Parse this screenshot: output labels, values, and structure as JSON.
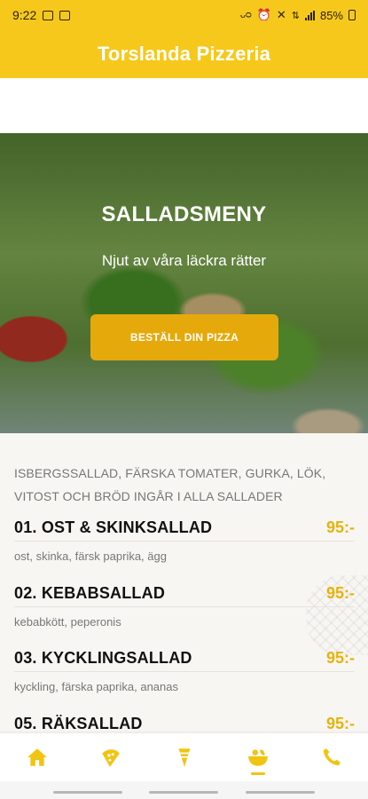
{
  "status_bar": {
    "time": "9:22",
    "battery": "85%",
    "icons": [
      "image-icon",
      "notification-icon",
      "wifi-calling-icon",
      "alarm-icon",
      "mute-icon",
      "data-icon",
      "signal-icon",
      "battery-icon"
    ]
  },
  "header": {
    "title": "Torslanda Pizzeria"
  },
  "hero": {
    "title": "SALLADSMENY",
    "subtitle": "Njut av våra läckra rätter",
    "order_button": "BESTÄLL DIN PIZZA"
  },
  "menu": {
    "note_line1": "ISBERGSSALLAD, FÄRSKA TOMATER, GURKA, LÖK,",
    "note_line2": "VITOST OCH BRÖD INGÅR I ALLA SALLADER",
    "items": [
      {
        "name": "01. OST & SKINKSALLAD",
        "price": "95:-",
        "desc": "ost, skinka, färsk paprika, ägg"
      },
      {
        "name": "02. KEBABSALLAD",
        "price": "95:-",
        "desc": "kebabkött, peperonis"
      },
      {
        "name": "03. KYCKLINGSALLAD",
        "price": "95:-",
        "desc": "kyckling, färska paprika, ananas"
      },
      {
        "name": "05. RÄKSALLAD",
        "price": "95:-",
        "desc": ""
      }
    ]
  },
  "bottom_nav": {
    "items": [
      "home-icon",
      "pizza-icon",
      "kebab-icon",
      "salad-icon",
      "phone-icon"
    ],
    "active_index": 3
  },
  "colors": {
    "brand_yellow": "#f6c81c",
    "button_orange": "#e6a90c",
    "price_yellow": "#e6b30b"
  }
}
